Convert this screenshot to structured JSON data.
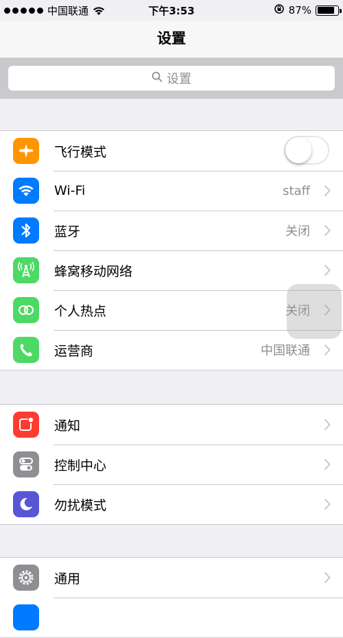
{
  "status_bar": {
    "carrier": "中国联通",
    "time": "下午3:53",
    "battery": "87%",
    "battery_level": 0.87
  },
  "nav": {
    "title": "设置"
  },
  "search": {
    "placeholder": "设置"
  },
  "groups": [
    {
      "items": [
        {
          "label": "飞行模式",
          "value": "",
          "icon": "airplane-icon",
          "icon_color": "#ff9500",
          "toggle": false
        },
        {
          "label": "Wi-Fi",
          "value": "staff",
          "icon": "wifi-icon",
          "icon_color": "#007aff"
        },
        {
          "label": "蓝牙",
          "value": "关闭",
          "icon": "bluetooth-icon",
          "icon_color": "#007aff"
        },
        {
          "label": "蜂窝移动网络",
          "value": "",
          "icon": "cellular-icon",
          "icon_color": "#4cd964"
        },
        {
          "label": "个人热点",
          "value": "关闭",
          "icon": "hotspot-icon",
          "icon_color": "#4cd964"
        },
        {
          "label": "运营商",
          "value": "中国联通",
          "icon": "phone-icon",
          "icon_color": "#4cd964"
        }
      ]
    },
    {
      "items": [
        {
          "label": "通知",
          "value": "",
          "icon": "notifications-icon",
          "icon_color": "#ff3b30"
        },
        {
          "label": "控制中心",
          "value": "",
          "icon": "control-center-icon",
          "icon_color": "#8e8e93"
        },
        {
          "label": "勿扰模式",
          "value": "",
          "icon": "moon-icon",
          "icon_color": "#5856d6"
        }
      ]
    },
    {
      "items": [
        {
          "label": "通用",
          "value": "",
          "icon": "gear-icon",
          "icon_color": "#8e8e93"
        }
      ]
    }
  ]
}
